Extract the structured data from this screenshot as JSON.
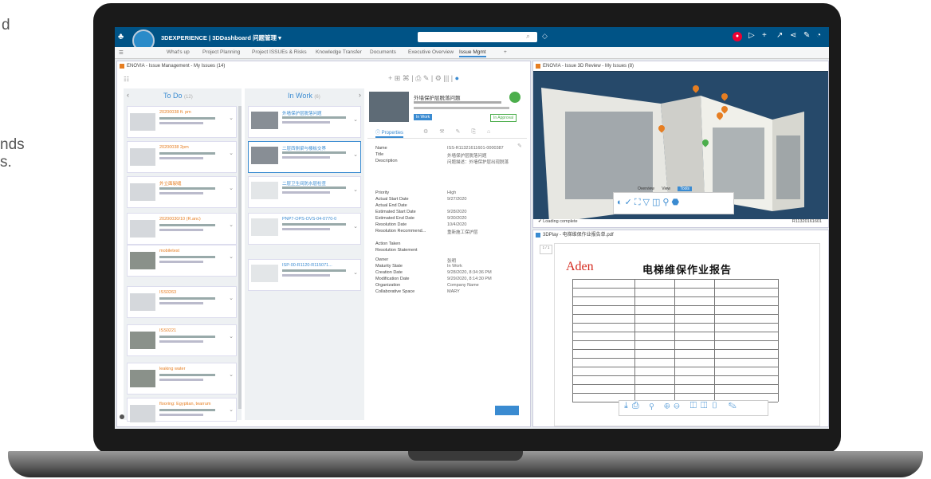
{
  "background_text": [
    "d",
    "nds",
    "s."
  ],
  "topbar": {
    "app_title": "3DEXPERIENCE | 3DDashboard 问题管理 ▾",
    "icons": [
      "3ds-logo-icon",
      "avatar",
      "search-icon",
      "tag-icon",
      "record-icon",
      "share-icon",
      "add-icon",
      "feedback-icon",
      "network-icon",
      "tools-icon",
      "help-icon"
    ]
  },
  "tabs": [
    "What's up",
    "Project Planning",
    "Project ISSUEs & Risks",
    "Knowledge Transfer",
    "Documents",
    "Executive Overview",
    "Issue Mgmt",
    "+"
  ],
  "issue_panel": {
    "title": "ENOVIA - Issue Management - My Issues (14)",
    "todo_label": "To Do",
    "todo_count": "(12)",
    "inwork_label": "In Work",
    "inwork_count": "(6)",
    "todo_cards": [
      {
        "id": "20200038 ft. pm"
      },
      {
        "id": "20200038 2pm"
      },
      {
        "id": "外立面裂缝"
      },
      {
        "id": "20200030/10 (R.anc)"
      },
      {
        "id": "mobiletest"
      },
      {
        "id": "ISS0263"
      },
      {
        "id": "ISS0221"
      },
      {
        "id": "leaking water"
      },
      {
        "id": "flooring: Egyptian, tearrum"
      }
    ],
    "inwork_cards": [
      {
        "id": "外墙保护层脱落问题"
      },
      {
        "id": "二层西侧梁与楼板交界"
      },
      {
        "id": "二层卫生间防水层检查"
      },
      {
        "id": "PNP7-OPS-OVS-04-0770-0"
      },
      {
        "id": "ISP-00-R1120-R115071..."
      }
    ]
  },
  "detail_panel": {
    "issue_title": "外墙保护层脱落问题",
    "status_badge": "In Work",
    "approval_badge": "In Approval",
    "properties_tab": "Properties",
    "fields": [
      {
        "label": "Name",
        "value": "ISS-R11321611601-0000387"
      },
      {
        "label": "Title",
        "value": "外墙保护层脱落问题"
      },
      {
        "label": "Description",
        "value": "问题描述：外墙保护层出现脱落"
      },
      {
        "label": "Priority",
        "value": "High"
      },
      {
        "label": "Actual Start Date",
        "value": "9/27/2020"
      },
      {
        "label": "Actual End Date",
        "value": ""
      },
      {
        "label": "Estimated Start Date",
        "value": "9/28/2020"
      },
      {
        "label": "Estimated End Date",
        "value": "9/30/2020"
      },
      {
        "label": "Resolution Date",
        "value": "10/4/2020"
      },
      {
        "label": "Resolution Recommend...",
        "value": "重新施工保护层"
      },
      {
        "label": "Action Taken",
        "value": ""
      },
      {
        "label": "Resolution Statement",
        "value": ""
      },
      {
        "label": "Owner",
        "value": "张明"
      },
      {
        "label": "Maturity State",
        "value": "In Work"
      },
      {
        "label": "Creation Date",
        "value": "9/28/2020, 8:34:36 PM"
      },
      {
        "label": "Modification Date",
        "value": "9/29/2020, 8:14:30 PM"
      },
      {
        "label": "Organization",
        "value": "Company Name"
      },
      {
        "label": "Collaborative Space",
        "value": "MARY"
      }
    ]
  },
  "review_panel": {
    "title": "ENOVIA - Issue 3D Review - My Issues (8)",
    "status": "Loading complete",
    "segments": [
      "Overview",
      "View",
      "Tools"
    ],
    "id_label": "R11320161601"
  },
  "doc_panel": {
    "title": "3DPlay - 电梯维保作业报告单.pdf",
    "brand": "Aden",
    "doc_heading": "电梯维保作业报告",
    "page_label": "1 / 1"
  },
  "colors": {
    "topbar": "#005386",
    "accent": "#3a8bd1",
    "orange": "#e67e22"
  }
}
